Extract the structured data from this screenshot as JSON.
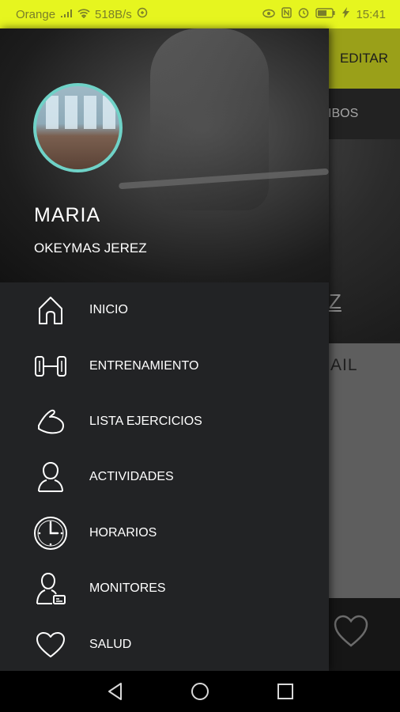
{
  "status_bar": {
    "carrier": "Orange",
    "net_speed": "518B/s",
    "battery": "57",
    "time": "15:41"
  },
  "background_app": {
    "edit_button": "EDITAR",
    "tab_fragment": "IBOS",
    "letter_fragment": "Z",
    "panel_text_fragment": "AIL"
  },
  "drawer": {
    "user": {
      "name": "MARIA",
      "gym": "OKEYMAS JEREZ"
    },
    "menu": [
      {
        "label": "INICIO",
        "icon": "home-icon"
      },
      {
        "label": "ENTRENAMIENTO",
        "icon": "dumbbell-icon"
      },
      {
        "label": "LISTA EJERCICIOS",
        "icon": "arm-icon"
      },
      {
        "label": "ACTIVIDADES",
        "icon": "person-icon"
      },
      {
        "label": "HORARIOS",
        "icon": "clock-icon"
      },
      {
        "label": "MONITORES",
        "icon": "monitor-badge-icon"
      },
      {
        "label": "SALUD",
        "icon": "heart-icon"
      }
    ]
  },
  "colors": {
    "status_bar": "#e6f51f",
    "accent_edit": "#9aa019",
    "avatar_ring": "#6fd2c7",
    "drawer_bg": "#222325"
  }
}
